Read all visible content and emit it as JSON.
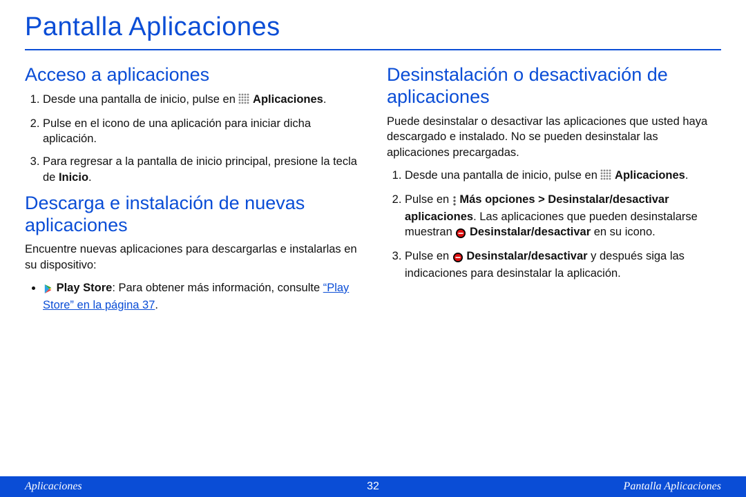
{
  "title": "Pantalla Aplicaciones",
  "left": {
    "section1": {
      "heading": "Acceso a aplicaciones",
      "step1_a": "Desde una pantalla de inicio, pulse en ",
      "step1_b": "Aplicaciones",
      "step1_c": ".",
      "step2": "Pulse en el icono de una aplicación para iniciar dicha aplicación.",
      "step3_a": "Para regresar a la pantalla de inicio principal, presione la tecla de ",
      "step3_b": "Inicio",
      "step3_c": "."
    },
    "section2": {
      "heading": "Descarga e instalación de nuevas aplicaciones",
      "intro": "Encuentre nuevas aplicaciones para descargarlas e instalarlas en su dispositivo:",
      "bullet_a": "Play Store",
      "bullet_b": ": Para obtener más información, consulte ",
      "bullet_link": "“Play Store” en la página 37",
      "bullet_c": "."
    }
  },
  "right": {
    "section1": {
      "heading": "Desinstalación o desactivación de aplicaciones",
      "intro": "Puede desinstalar o desactivar las aplicaciones que usted haya descargado e instalado. No se pueden desinstalar las aplicaciones precargadas.",
      "step1_a": "Desde una pantalla de inicio, pulse en ",
      "step1_b": "Aplicaciones",
      "step1_c": ".",
      "step2_a": "Pulse en ",
      "step2_b": "Más opciones > Desinstalar/desactivar aplicaciones",
      "step2_c": ". Las aplicaciones que pueden desinstalarse muestran ",
      "step2_d": "Desinstalar/desactivar",
      "step2_e": " en su icono.",
      "step3_a": "Pulse en ",
      "step3_b": "Desinstalar/desactivar",
      "step3_c": " y después siga las indicaciones para desinstalar la aplicación."
    }
  },
  "footer": {
    "left": "Aplicaciones",
    "page": "32",
    "right": "Pantalla Aplicaciones"
  }
}
